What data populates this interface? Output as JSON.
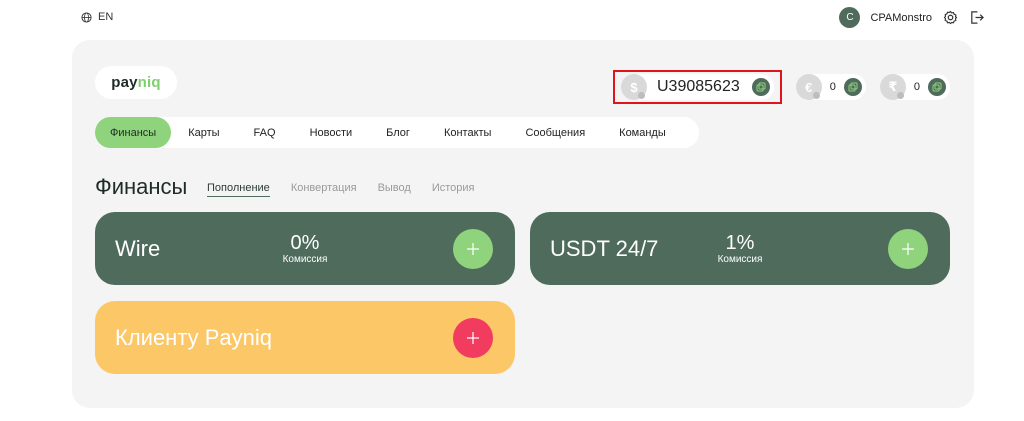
{
  "topbar": {
    "language": "EN",
    "user_initial": "C",
    "username": "CPAMonstro"
  },
  "logo": {
    "part1": "pay",
    "part2": "niq"
  },
  "balances": {
    "main": {
      "currency_symbol": "$",
      "account_id": "U39085623"
    },
    "eur": {
      "currency_symbol": "€",
      "value": "0"
    },
    "inr": {
      "currency_symbol": "₹",
      "value": "0"
    }
  },
  "nav": {
    "items": [
      "Финансы",
      "Карты",
      "FAQ",
      "Новости",
      "Блог",
      "Контакты",
      "Сообщения",
      "Команды"
    ]
  },
  "finance": {
    "title": "Финансы",
    "subtabs": [
      "Пополнение",
      "Конвертация",
      "Вывод",
      "История"
    ]
  },
  "cards": {
    "wire": {
      "name": "Wire",
      "commission": "0%",
      "commission_label": "Комиссия"
    },
    "usdt": {
      "name": "USDT 24/7",
      "commission": "1%",
      "commission_label": "Комиссия"
    },
    "client": {
      "name": "Клиенту Payniq"
    }
  },
  "colors": {
    "accent_green": "#8fd37d",
    "dark_green": "#4e6b5c",
    "yellow": "#fcc766",
    "pink": "#f23c5f",
    "highlight_red": "#e0151b"
  }
}
